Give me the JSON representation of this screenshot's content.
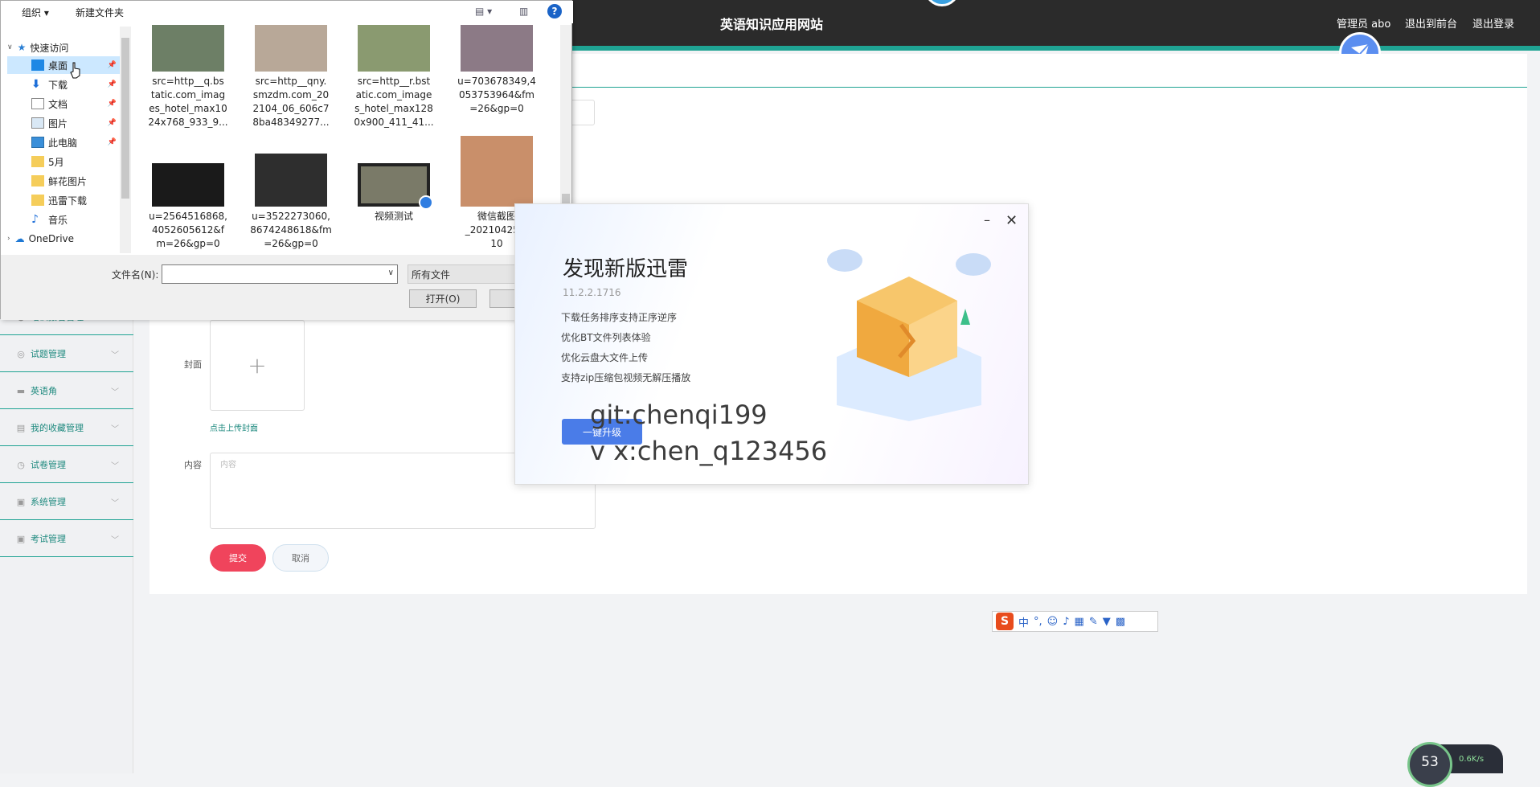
{
  "app": {
    "site_title": "英语知识应用网站",
    "admin": "管理员 abo",
    "back_front": "退出到前台",
    "logout": "退出登录"
  },
  "sidebar": {
    "items": [
      {
        "label": "培训报名管理",
        "icon": "user-icon"
      },
      {
        "label": "试题管理",
        "icon": "circle-icon"
      },
      {
        "label": "英语角",
        "icon": "briefcase-icon"
      },
      {
        "label": "我的收藏管理",
        "icon": "db-icon"
      },
      {
        "label": "试卷管理",
        "icon": "clock-icon"
      },
      {
        "label": "系统管理",
        "icon": "clipboard-icon"
      },
      {
        "label": "考试管理",
        "icon": "clipboard-icon"
      }
    ]
  },
  "form": {
    "cover_label": "封面",
    "cover_plus": "+",
    "cover_hint": "点击上传封面",
    "content_label": "内容",
    "content_placeholder": "内容",
    "submit": "提交",
    "cancel": "取消"
  },
  "file_dialog": {
    "organize": "组织 ▾",
    "new_folder": "新建文件夹",
    "tree": [
      {
        "label": "快速访问",
        "icon": "star-icon"
      },
      {
        "label": "桌面",
        "icon": "desktop-icon",
        "selected": true,
        "pinned": true
      },
      {
        "label": "下载",
        "icon": "download-icon",
        "pinned": true
      },
      {
        "label": "文档",
        "icon": "document-icon",
        "pinned": true
      },
      {
        "label": "图片",
        "icon": "picture-icon",
        "pinned": true
      },
      {
        "label": "此电脑",
        "icon": "computer-icon",
        "pinned": true
      },
      {
        "label": "5月",
        "icon": "folder-icon"
      },
      {
        "label": "鲜花图片",
        "icon": "folder-icon"
      },
      {
        "label": "迅雷下载",
        "icon": "folder-icon"
      },
      {
        "label": "音乐",
        "icon": "music-icon"
      },
      {
        "label": "OneDrive",
        "icon": "cloud-icon"
      }
    ],
    "files": [
      {
        "name": "src=http__q.bstatic.com_images_hotel_max1024x768_933_9...",
        "lines": [
          "src=http__q.bs",
          "tatic.com_imag",
          "es_hotel_max10",
          "24x768_933_9..."
        ],
        "color": "#6d7f66"
      },
      {
        "name": "src=http__qny.smzdm.com_202104_06_606c78ba48349277...",
        "lines": [
          "src=http__qny.",
          "smzdm.com_20",
          "2104_06_606c7",
          "8ba48349277..."
        ],
        "color": "#b8a898"
      },
      {
        "name": "src=http__r.bstatic.com_images_hotel_max1280x900_411_41...",
        "lines": [
          "src=http__r.bst",
          "atic.com_image",
          "s_hotel_max128",
          "0x900_411_41..."
        ],
        "color": "#8a9a70"
      },
      {
        "name": "u=703678349,4053753964&fm=26&gp=0",
        "lines": [
          "u=703678349,4",
          "053753964&fm",
          "=26&gp=0"
        ],
        "color": "#8c7a86"
      },
      {
        "name": "u=2564516868,4052605612&fm=26&gp=0",
        "lines": [
          "u=2564516868,",
          "4052605612&f",
          "m=26&gp=0"
        ],
        "color": "#1a1a1a"
      },
      {
        "name": "u=3522273060,8674248618&fm=26&gp=0",
        "lines": [
          "u=3522273060,",
          "8674248618&fm",
          "=26&gp=0"
        ],
        "color": "#2e2e2e"
      },
      {
        "name": "视频测试",
        "lines": [
          "视频测试"
        ],
        "color": "#7a7a68"
      },
      {
        "name": "微信截图_2021042510",
        "lines": [
          "微信截图",
          "_20210425 1",
          "10"
        ],
        "color": "#c98f6a"
      }
    ],
    "filename_label": "文件名(N):",
    "filename_value": "",
    "filetype": "所有文件",
    "open": "打开(O)"
  },
  "xunlei": {
    "title": "发现新版迅雷",
    "version": "11.2.2.1716",
    "features": [
      "下载任务排序支持正序逆序",
      "优化BT文件列表体验",
      "优化云盘大文件上传",
      "支持zip压缩包视频无解压播放"
    ],
    "upgrade": "一键升级",
    "min": "–",
    "close": "✕"
  },
  "watermark": {
    "line1": "git:chenqi199",
    "line2": "v x:chen_q123456"
  },
  "ime": {
    "logo": "S",
    "mode": "中"
  },
  "speed": {
    "percent": "53",
    "rate": "0.6K/s"
  }
}
